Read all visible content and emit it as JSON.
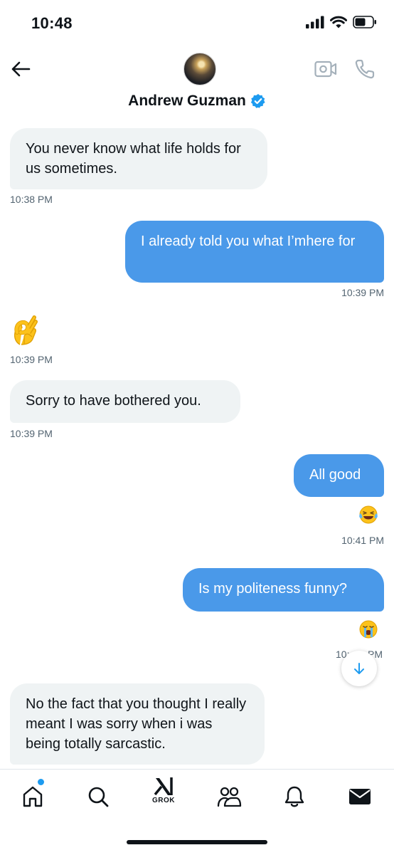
{
  "status_bar": {
    "time": "10:48"
  },
  "header": {
    "contact_name": "Andrew Guzman",
    "verified": true
  },
  "messages": [
    {
      "direction": "incoming",
      "text": "You never know what life holds for us sometimes.",
      "time": "10:38 PM"
    },
    {
      "direction": "outgoing",
      "text": "I already told you what I’mhere for",
      "time": "10:39 PM"
    },
    {
      "direction": "incoming",
      "emoji": "ok-hand-icon",
      "time": "10:39 PM"
    },
    {
      "direction": "incoming",
      "text": "Sorry to have bothered you.",
      "time": "10:39 PM"
    },
    {
      "direction": "outgoing",
      "text": "All good",
      "reaction": "laughing-tears-icon",
      "time": "10:41 PM"
    },
    {
      "direction": "outgoing",
      "text": "Is my politeness funny?",
      "reaction": "crying-face-icon",
      "time": "10:__PM"
    },
    {
      "direction": "incoming",
      "text": "No the fact that you thought I really meant I was sorry when i was being totally sarcastic."
    }
  ],
  "ts_partial": {
    "left": "10:",
    "right": "PM"
  },
  "tabbar": {
    "items": [
      "home-icon",
      "search-icon",
      "grok-icon",
      "communities-icon",
      "notifications-icon",
      "messages-icon"
    ],
    "grok_label": "GROK"
  },
  "colors": {
    "outgoing_bubble": "#4a99e9",
    "incoming_bubble": "#eff3f4",
    "verified_badge": "#1d9bf0",
    "accent": "#1d9bf0"
  }
}
